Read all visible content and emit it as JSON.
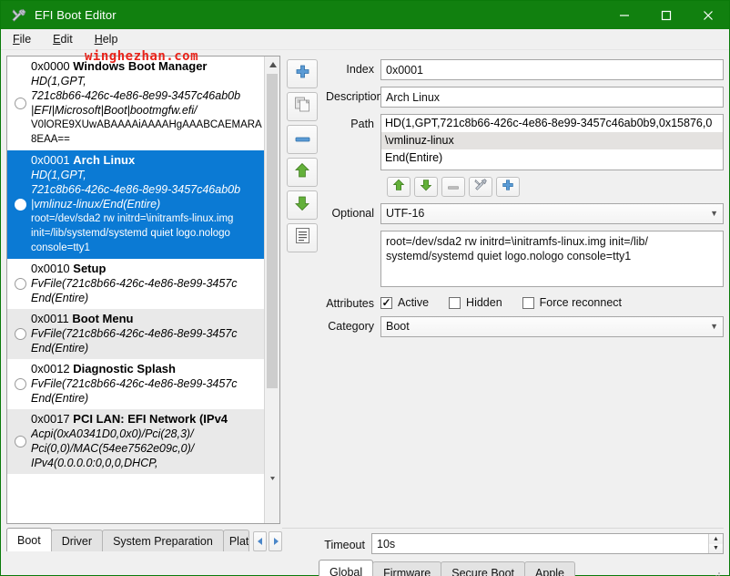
{
  "window": {
    "title": "EFI Boot Editor",
    "icon": "tools-icon",
    "title_bar_color": "#11800f",
    "controls": {
      "minimize": "minimize-icon",
      "maximize": "maximize-icon",
      "close": "close-icon"
    }
  },
  "watermark": {
    "text": "winghezhan.com",
    "color": "#e8231a"
  },
  "menu": [
    {
      "mnemonic": "F",
      "rest": "ile"
    },
    {
      "mnemonic": "E",
      "rest": "dit"
    },
    {
      "mnemonic": "H",
      "rest": "elp"
    }
  ],
  "boot_list": {
    "selected_index": 1,
    "items": [
      {
        "index": "0x0000",
        "name": "Windows Boot Manager",
        "path_lines": "HD(1,GPT,\n721c8b66-426c-4e86-8e99-3457c46ab0b\n|EFI|Microsoft|Boot|bootmgfw.efi/",
        "optional": "V0lORE9XUwABAAAAiAAAAHgAAABCAEMARAI\n8EAA=="
      },
      {
        "index": "0x0001",
        "name": "Arch Linux",
        "path_lines": "HD(1,GPT,\n721c8b66-426c-4e86-8e99-3457c46ab0b\n|vmlinuz-linux/End(Entire)",
        "optional": "root=/dev/sda2 rw initrd=\\initramfs-linux.img\ninit=/lib/systemd/systemd quiet logo.nologo\nconsole=tty1"
      },
      {
        "index": "0x0010",
        "name": "Setup",
        "path_lines": "FvFile(721c8b66-426c-4e86-8e99-3457c\nEnd(Entire)",
        "optional": ""
      },
      {
        "index": "0x0011",
        "name": "Boot Menu",
        "path_lines": "FvFile(721c8b66-426c-4e86-8e99-3457c\nEnd(Entire)",
        "optional": ""
      },
      {
        "index": "0x0012",
        "name": "Diagnostic Splash",
        "path_lines": "FvFile(721c8b66-426c-4e86-8e99-3457c\nEnd(Entire)",
        "optional": ""
      },
      {
        "index": "0x0017",
        "name": "PCI LAN: EFI Network (IPv4",
        "path_lines": "Acpi(0xA0341D0,0x0)/Pci(28,3)/\nPci(0,0)/MAC(54ee7562e09c,0)/\nIPv4(0.0.0.0:0,0,0,DHCP,",
        "optional": ""
      }
    ]
  },
  "list_toolbar": [
    {
      "name": "add-entry-button",
      "icon": "plus-icon",
      "enabled": true
    },
    {
      "name": "copy-entry-button",
      "icon": "copy-icon",
      "enabled": false
    },
    {
      "name": "remove-entry-button",
      "icon": "minus-icon",
      "enabled": true
    },
    {
      "name": "move-up-button",
      "icon": "arrow-up-icon",
      "enabled": true
    },
    {
      "name": "move-down-button",
      "icon": "arrow-down-icon",
      "enabled": true
    },
    {
      "name": "properties-button",
      "icon": "document-icon",
      "enabled": true
    }
  ],
  "details": {
    "index_label": "Index",
    "index_value": "0x0001",
    "description_label": "Description",
    "description_value": "Arch Linux",
    "path_label": "Path",
    "path_rows": [
      {
        "text": "HD(1,GPT,721c8b66-426c-4e86-8e99-3457c46ab0b9,0x15876,0",
        "highlighted": false
      },
      {
        "text": "\\vmlinuz-linux",
        "highlighted": true
      },
      {
        "text": "End(Entire)",
        "highlighted": false
      }
    ],
    "path_tools": [
      {
        "name": "path-move-up-button",
        "icon": "arrow-up-icon",
        "enabled": true
      },
      {
        "name": "path-move-down-button",
        "icon": "arrow-down-icon",
        "enabled": true
      },
      {
        "name": "path-remove-button",
        "icon": "minus-icon",
        "enabled": false
      },
      {
        "name": "path-edit-button",
        "icon": "tools-icon",
        "enabled": true
      },
      {
        "name": "path-add-button",
        "icon": "plus-icon",
        "enabled": true
      }
    ],
    "optional_label": "Optional",
    "optional_encoding": "UTF-16",
    "optional_value": "root=/dev/sda2 rw initrd=\\initramfs-linux.img init=/lib/\nsystemd/systemd quiet logo.nologo console=tty1",
    "attributes_label": "Attributes",
    "attributes": [
      {
        "label": "Active",
        "checked": true
      },
      {
        "label": "Hidden",
        "checked": false
      },
      {
        "label": "Force reconnect",
        "checked": false
      }
    ],
    "category_label": "Category",
    "category_value": "Boot"
  },
  "bottom": {
    "left_tabs": [
      {
        "label": "Boot",
        "active": true
      },
      {
        "label": "Driver",
        "active": false
      },
      {
        "label": "System Preparation",
        "active": false
      },
      {
        "label": "Platf",
        "active": false
      }
    ],
    "tab_scroll_left": "chevron-left-icon",
    "tab_scroll_right": "chevron-right-icon",
    "timeout_label": "Timeout",
    "timeout_value": "10s",
    "right_tabs": [
      {
        "label": "Global",
        "active": true
      },
      {
        "label": "Firmware",
        "active": false
      },
      {
        "label": "Secure Boot",
        "active": false
      },
      {
        "label": "Apple",
        "active": false
      }
    ]
  }
}
